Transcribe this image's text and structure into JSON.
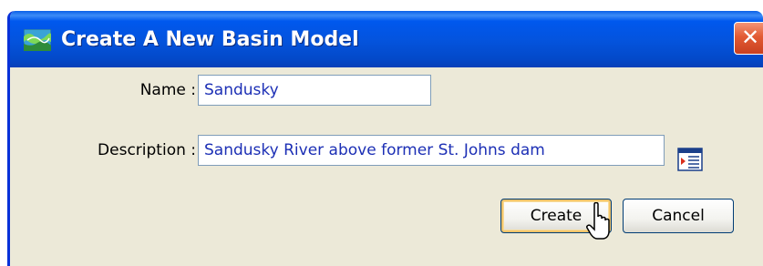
{
  "window": {
    "title": "Create A New Basin Model",
    "icon": "basin-model-icon",
    "close_glyph": "✕"
  },
  "form": {
    "name_label": "Name :",
    "name_value": "Sandusky",
    "description_label": "Description :",
    "description_value": "Sandusky River above former St. Johns dam",
    "description_editor_icon": "text-editor-icon"
  },
  "buttons": {
    "create_label": "Create",
    "cancel_label": "Cancel"
  },
  "colors": {
    "titlebar": "#0453dc",
    "dialog_background": "#ece9d8",
    "field_text": "#1c2fb5",
    "close_button": "#e25a33"
  }
}
